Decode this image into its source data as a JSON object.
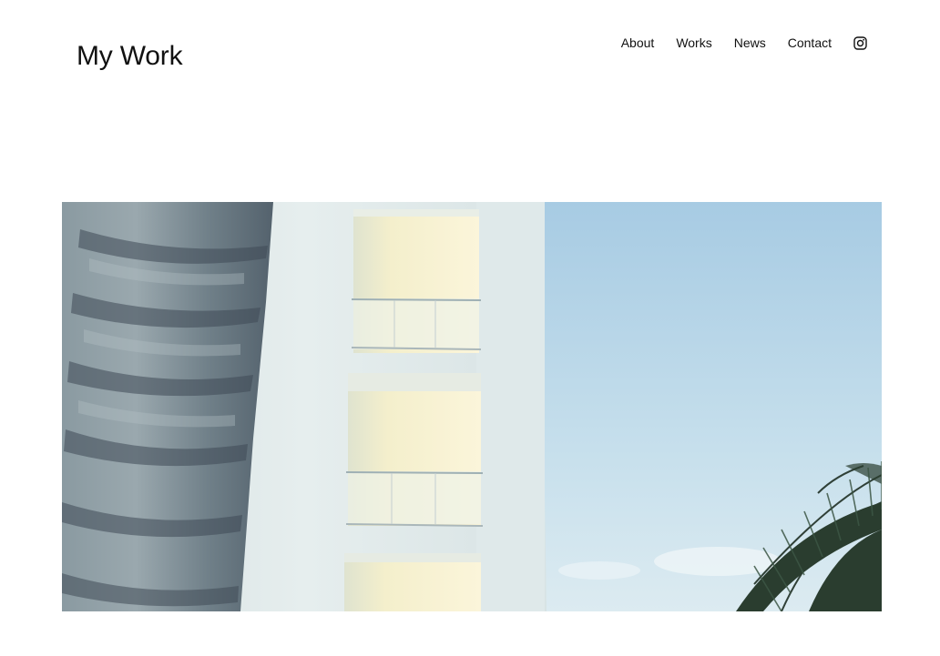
{
  "site": {
    "title": "My Work"
  },
  "nav": {
    "items": [
      {
        "label": "About"
      },
      {
        "label": "Works"
      },
      {
        "label": "News"
      },
      {
        "label": "Contact"
      }
    ],
    "social_icon": "instagram-icon"
  },
  "hero": {
    "subject": "white building balconies with palm tree trunk and fronds against blue sky",
    "colors": {
      "sky_top": "#a9cde4",
      "sky_bottom": "#dbeaf1",
      "wall": "#dfe8e9",
      "balcony_light": "#f5efcf",
      "trunk": "#7d8d96"
    }
  }
}
